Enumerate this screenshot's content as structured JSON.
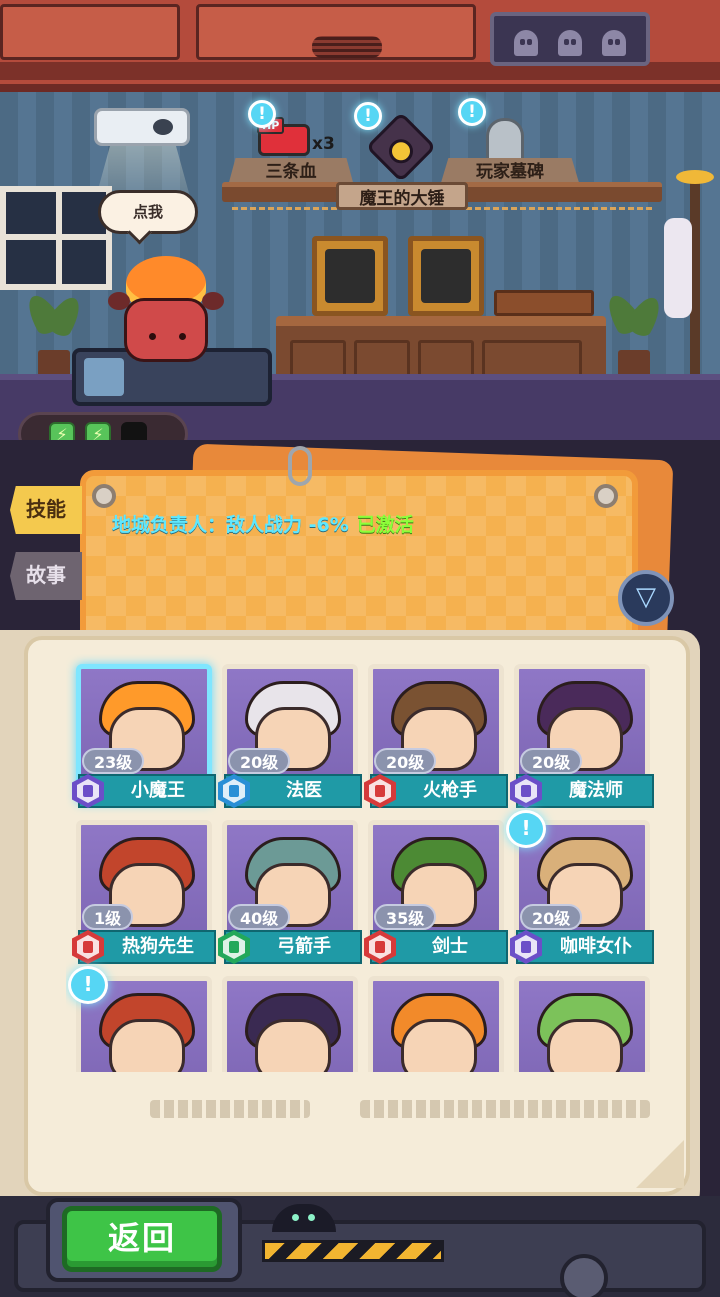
{
  "shop": {
    "items": [
      {
        "label": "三条血",
        "badge": "HP",
        "quantity": "x3"
      },
      {
        "label": "魔王的大锤"
      },
      {
        "label": "玩家墓碑"
      }
    ],
    "alert_glyph": "!"
  },
  "hero": {
    "speech": "点我",
    "energy": {
      "full": 2,
      "total": 3,
      "glyph": "⚡"
    }
  },
  "tabs": [
    {
      "label": "技能",
      "active": true
    },
    {
      "label": "故事",
      "active": false
    }
  ],
  "notice": {
    "text": "地城负责人：敌人战力 -6%",
    "status": "已激活",
    "text_color": "#5fe8ff",
    "status_color": "#8cff3a"
  },
  "filter": {
    "icon": "filter-funnel-icon",
    "glyph": "▽"
  },
  "roster": [
    {
      "name": "小魔王",
      "level": "23级",
      "class_color": "#6b4fc8",
      "hair": "#ff9a2a",
      "selected": true,
      "alert": false
    },
    {
      "name": "法医",
      "level": "20级",
      "class_color": "#2a8fd6",
      "hair": "#e8e4ea",
      "selected": false,
      "alert": false
    },
    {
      "name": "火枪手",
      "level": "20级",
      "class_color": "#d63a3a",
      "hair": "#7a5232",
      "selected": false,
      "alert": false
    },
    {
      "name": "魔法师",
      "level": "20级",
      "class_color": "#6b4fc8",
      "hair": "#4a2a5a",
      "selected": false,
      "alert": false
    },
    {
      "name": "热狗先生",
      "level": "1级",
      "class_color": "#d63a3a",
      "hair": "#c2452c",
      "selected": false,
      "alert": false
    },
    {
      "name": "弓箭手",
      "level": "40级",
      "class_color": "#23a85a",
      "hair": "#6c9a96",
      "selected": false,
      "alert": false
    },
    {
      "name": "剑士",
      "level": "35级",
      "class_color": "#d63a3a",
      "hair": "#4c8a34",
      "selected": false,
      "alert": false
    },
    {
      "name": "咖啡女仆",
      "level": "20级",
      "class_color": "#6b4fc8",
      "hair": "#d9b07a",
      "selected": false,
      "alert": true
    },
    {
      "name": "",
      "level": "",
      "class_color": "#d63a3a",
      "hair": "#c2452c",
      "selected": false,
      "alert": true
    },
    {
      "name": "",
      "level": "",
      "class_color": "#6b4fc8",
      "hair": "#3a2a52",
      "selected": false,
      "alert": false
    },
    {
      "name": "",
      "level": "",
      "class_color": "#d63a3a",
      "hair": "#f28a2a",
      "selected": false,
      "alert": false
    },
    {
      "name": "",
      "level": "",
      "class_color": "#23a85a",
      "hair": "#7cc25a",
      "selected": false,
      "alert": false
    }
  ],
  "footer": {
    "back_label": "返回"
  }
}
